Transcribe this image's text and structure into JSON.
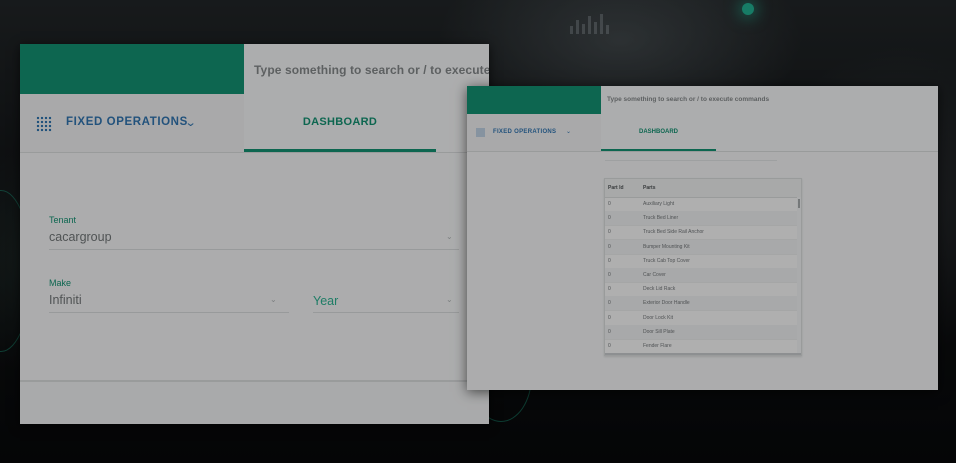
{
  "colors": {
    "accent": "#128a6c",
    "nav_blue": "#2f6fa8",
    "background": "#0b0d0e"
  },
  "left_panel": {
    "search": {
      "placeholder": "Type something to search or / to execute"
    },
    "nav": {
      "label": "FIXED OPERATIONS",
      "menu_icon": "grid-icon",
      "chevron": "⌄"
    },
    "tab": {
      "label": "DASHBOARD"
    },
    "form": {
      "tenant": {
        "label": "Tenant",
        "value": "cacargroup",
        "icon": "chevron-down-icon"
      },
      "make": {
        "label": "Make",
        "value": "Infiniti",
        "icon": "chevron-down-icon"
      },
      "year": {
        "label": "Year",
        "icon": "chevron-down-icon"
      }
    }
  },
  "right_panel": {
    "search": {
      "placeholder": "Type something to search or / to execute commands"
    },
    "nav": {
      "label": "FIXED OPERATIONS",
      "chevron": "⌄"
    },
    "tab": {
      "label": "DASHBOARD"
    },
    "table": {
      "columns": [
        "Part Id",
        "Parts"
      ],
      "rows": [
        {
          "id": "0",
          "part": "Auxiliary Light"
        },
        {
          "id": "0",
          "part": "Truck Bed Liner"
        },
        {
          "id": "0",
          "part": "Truck Bed Side Rail Anchor"
        },
        {
          "id": "0",
          "part": "Bumper Mounting Kit"
        },
        {
          "id": "0",
          "part": "Truck Cab Top Cover"
        },
        {
          "id": "0",
          "part": "Car Cover"
        },
        {
          "id": "0",
          "part": "Deck Lid Rack"
        },
        {
          "id": "0",
          "part": "Exterior Door Handle"
        },
        {
          "id": "0",
          "part": "Door Lock Kit"
        },
        {
          "id": "0",
          "part": "Door Sill Plate"
        },
        {
          "id": "0",
          "part": "Fender Flare"
        }
      ]
    }
  }
}
